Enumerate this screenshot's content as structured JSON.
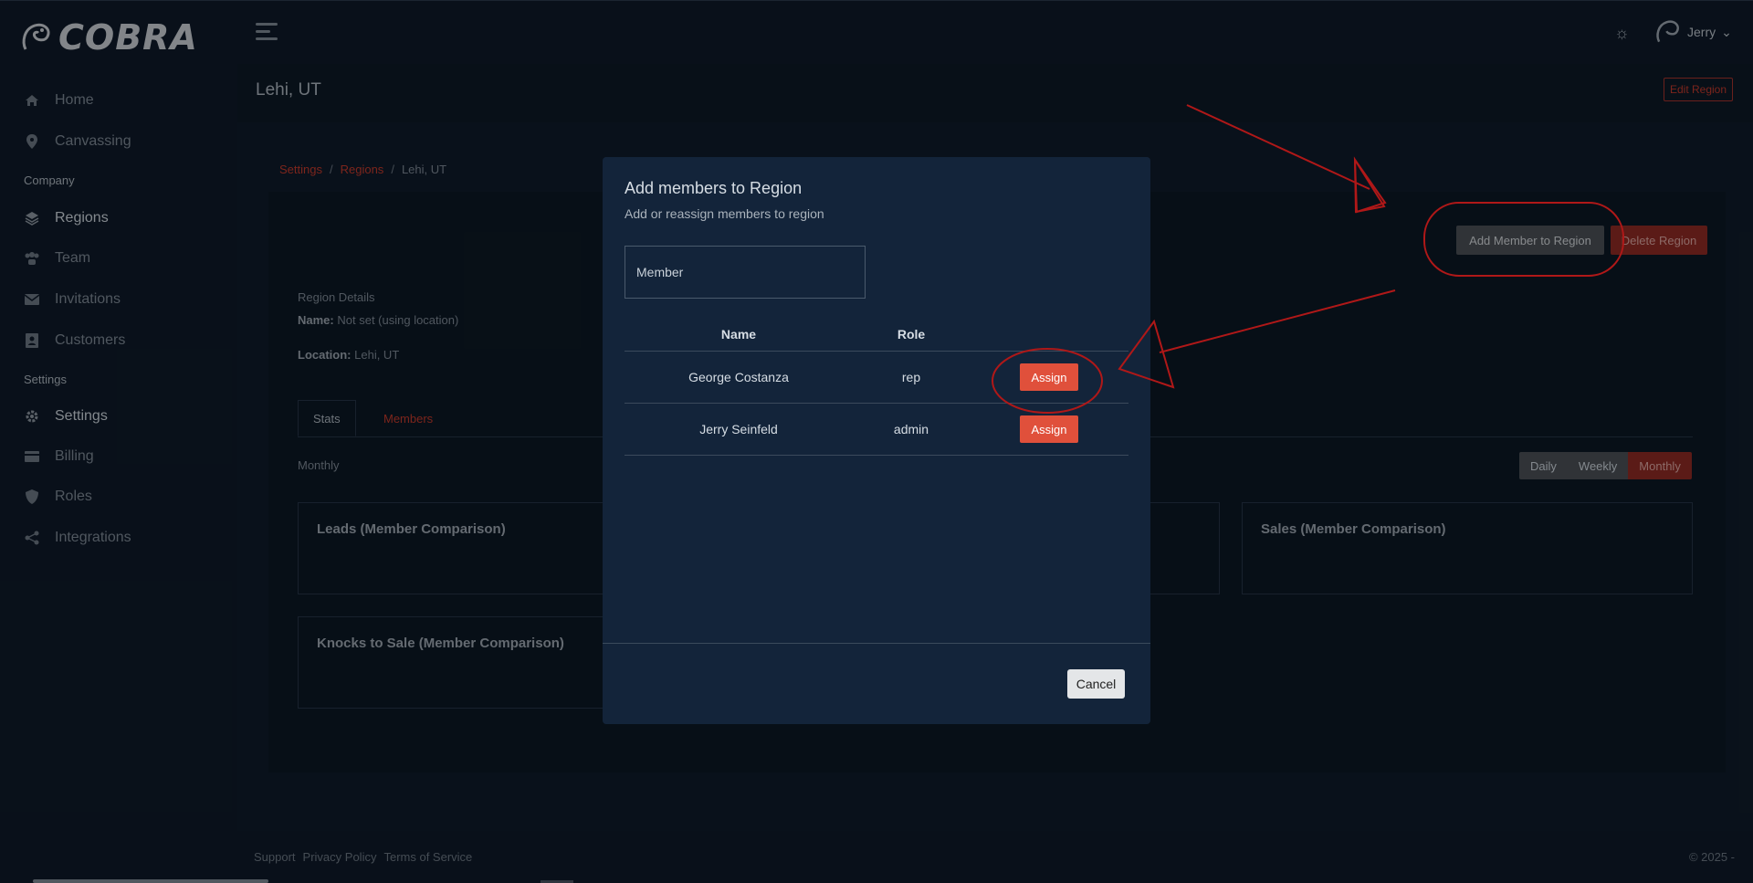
{
  "brand": {
    "name": "COBRA"
  },
  "topbar": {
    "user_name": "Jerry"
  },
  "sidebar": {
    "items": [
      {
        "label": "Home",
        "icon": "home-icon"
      },
      {
        "label": "Canvassing",
        "icon": "map-pin-icon"
      },
      {
        "label": "Regions",
        "icon": "layers-icon"
      },
      {
        "label": "Team",
        "icon": "team-icon"
      },
      {
        "label": "Invitations",
        "icon": "envelope-icon"
      },
      {
        "label": "Customers",
        "icon": "contact-book-icon"
      },
      {
        "label": "Settings",
        "icon": "gear-icon"
      },
      {
        "label": "Billing",
        "icon": "credit-card-icon"
      },
      {
        "label": "Roles",
        "icon": "shield-icon"
      },
      {
        "label": "Integrations",
        "icon": "share-icon"
      }
    ],
    "sections": {
      "company": "Company",
      "settings": "Settings"
    }
  },
  "page": {
    "title": "Lehi, UT",
    "edit_button": "Edit Region",
    "breadcrumb": [
      "Settings",
      "Regions",
      "Lehi, UT"
    ],
    "add_member_button": "Add Member to Region",
    "delete_button": "Delete Region",
    "details": {
      "heading": "Region Details",
      "name_label": "Name:",
      "name_value": "Not set (using location)",
      "location_label": "Location:",
      "location_value": "Lehi, UT"
    },
    "tabs": [
      "Stats",
      "Members"
    ],
    "period_label": "Monthly",
    "period_options": [
      "Daily",
      "Weekly",
      "Monthly"
    ],
    "period_selected": "Monthly",
    "charts": [
      "Leads (Member Comparison)",
      "Sales (Member Comparison)",
      "Knocks to Sale (Member Comparison)"
    ]
  },
  "footer": {
    "links": [
      "Support",
      "Privacy Policy",
      "Terms of Service"
    ],
    "copyright": "© 2025 -"
  },
  "modal": {
    "title": "Add members to Region",
    "subtitle": "Add or reassign members to region",
    "input_placeholder": "Member",
    "columns": [
      "Name",
      "Role"
    ],
    "rows": [
      {
        "name": "George Costanza",
        "role": "rep",
        "action": "Assign"
      },
      {
        "name": "Jerry Seinfeld",
        "role": "admin",
        "action": "Assign"
      }
    ],
    "cancel_button": "Cancel"
  },
  "colors": {
    "accent": "#c0392b",
    "assign": "#e0503b",
    "annotation": "#b01818",
    "background": "#0f1b2a"
  }
}
